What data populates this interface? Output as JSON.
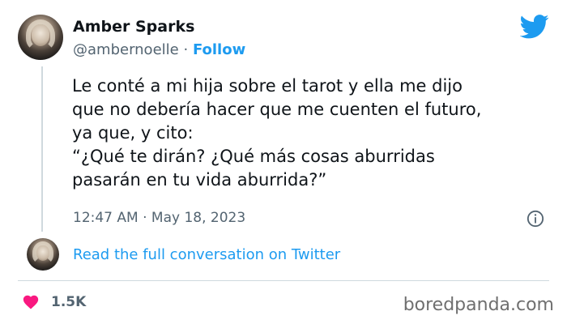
{
  "author": {
    "name": "Amber Sparks",
    "handle": "@ambernoelle",
    "separator": "·",
    "follow_label": "Follow"
  },
  "tweet": {
    "lines": [
      "Le conté a mi hija sobre el tarot y ella me dijo",
      "que no debería hacer que me cuenten el futuro,",
      "ya que, y cito:",
      "“¿Qué te dirán? ¿Qué más cosas aburridas",
      "pasarán en tu vida aburrida?”"
    ],
    "timestamp": "12:47 AM · May 18, 2023"
  },
  "conversation": {
    "link_label": "Read the full conversation on Twitter"
  },
  "engagement": {
    "likes": "1.5K"
  },
  "watermark": "boredpanda.com",
  "colors": {
    "brand": "#1d9bf0",
    "heart": "#f91880",
    "secondary_text": "#536471"
  },
  "icons": [
    "twitter-bird-icon",
    "info-icon",
    "heart-icon"
  ]
}
